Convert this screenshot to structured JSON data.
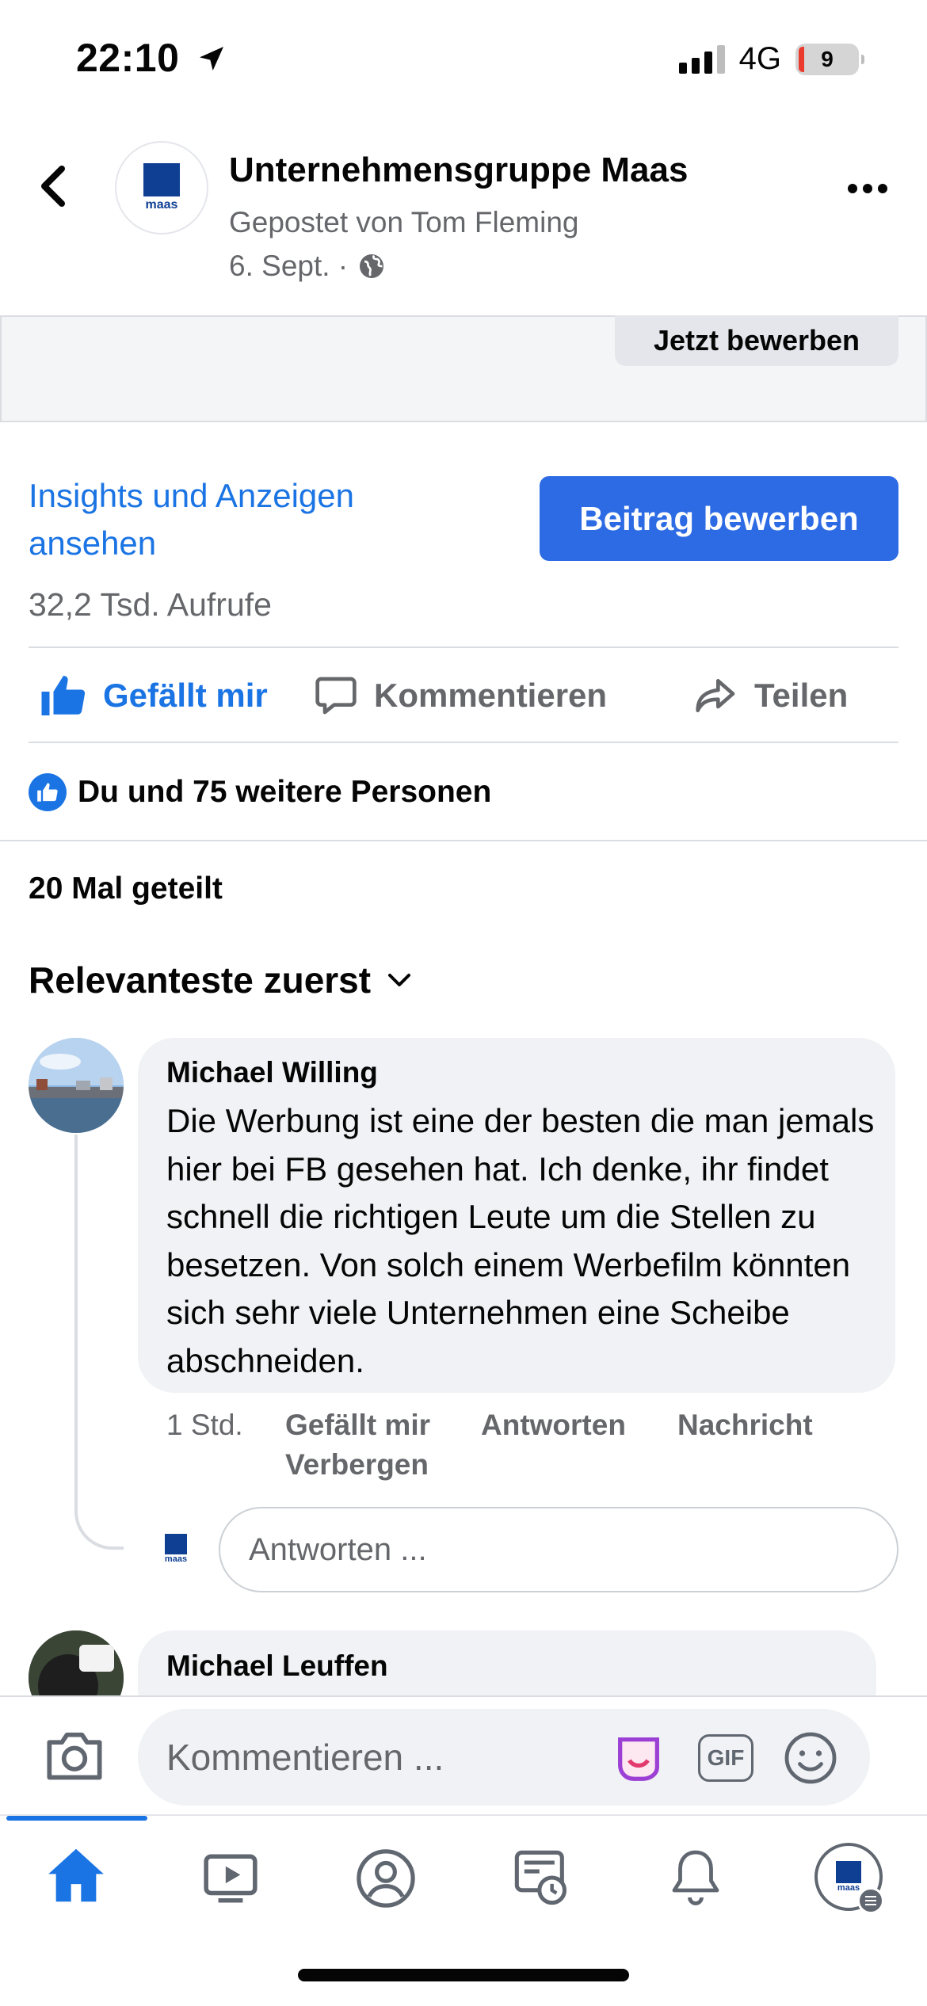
{
  "status_bar": {
    "time": "22:10",
    "network": "4G",
    "battery": "9"
  },
  "header": {
    "page_name": "Unternehmensgruppe Maas",
    "posted_by": "Gepostet von Tom Fleming",
    "date": "6. Sept. ·",
    "logo_text": "maas"
  },
  "ad": {
    "apply_label": "Jetzt bewerben"
  },
  "insights": {
    "link_label": "Insights und Anzeigen ansehen",
    "promote_label": "Beitrag bewerben",
    "views": "32,2 Tsd. Aufrufe"
  },
  "actions": {
    "like": "Gefällt mir",
    "comment": "Kommentieren",
    "share": "Teilen"
  },
  "reactions": {
    "text": "Du und 75 weitere Personen"
  },
  "shares": "20 Mal geteilt",
  "sort": {
    "label": "Relevanteste zuerst"
  },
  "comments": [
    {
      "author": "Michael Willing",
      "text": "Die Werbung ist eine der besten die man jemals hier bei FB gesehen hat. Ich denke, ihr findet schnell die richtigen Leute um die Stellen zu besetzen. Von solch einem Werbefilm könnten sich sehr viele Unternehmen eine Scheibe abschneiden.",
      "time": "1 Std.",
      "like": "Gefällt mir",
      "reply": "Antworten",
      "message": "Nachricht",
      "hide": "Verbergen"
    },
    {
      "author": "Michael Leuffen"
    }
  ],
  "reply_box": {
    "placeholder": "Antworten ..."
  },
  "composer": {
    "placeholder": "Kommentieren ...",
    "gif_label": "GIF"
  },
  "tabbar": {
    "tabs": [
      {
        "icon": "home-icon",
        "active": true
      },
      {
        "icon": "video-icon"
      },
      {
        "icon": "profile-icon"
      },
      {
        "icon": "feeds-icon"
      },
      {
        "icon": "notifications-icon"
      },
      {
        "icon": "menu-avatar-icon"
      }
    ]
  },
  "colors": {
    "accent": "#1b74e4",
    "button": "#2d6be4",
    "logo": "#0f3f93"
  }
}
